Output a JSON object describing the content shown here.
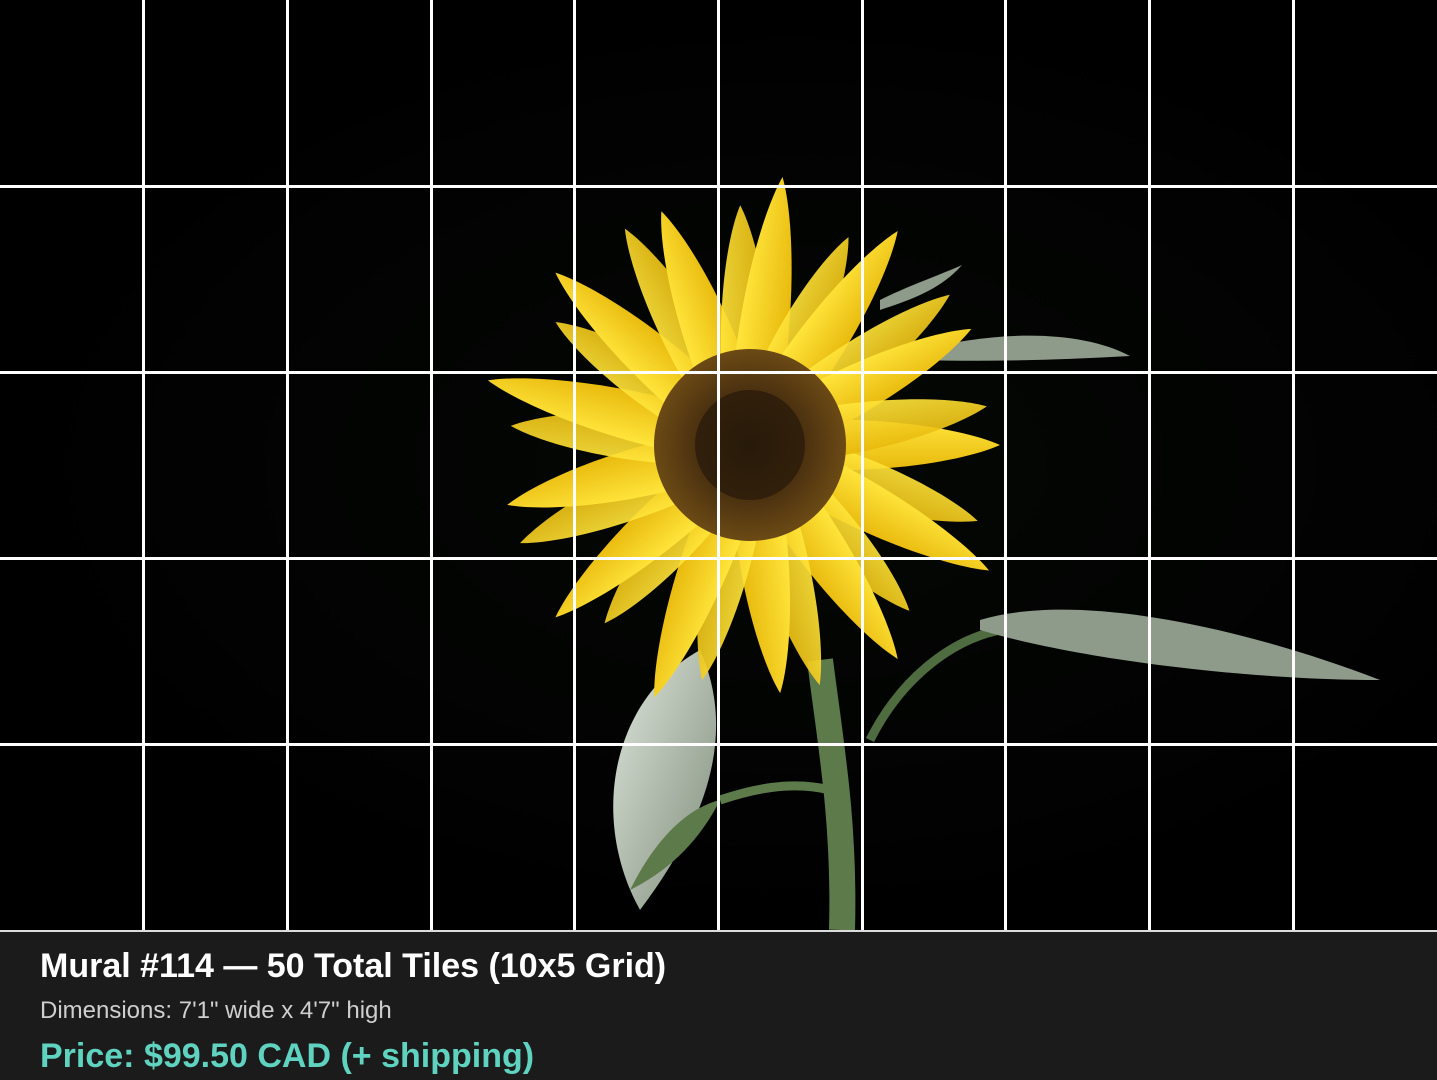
{
  "mural": {
    "grid": {
      "columns": 10,
      "rows": 5
    },
    "line_color": "#ffffff",
    "image_subject": "sunflower-icon"
  },
  "footer": {
    "title": "Mural #114 — 50 Total Tiles (10x5 Grid)",
    "dimensions": "Dimensions: 7'1\" wide x 4'7\" high",
    "price": "Price: $99.50 CAD (+ shipping)",
    "price_color": "#5fd3c0",
    "background_color": "#1b1b1b"
  }
}
